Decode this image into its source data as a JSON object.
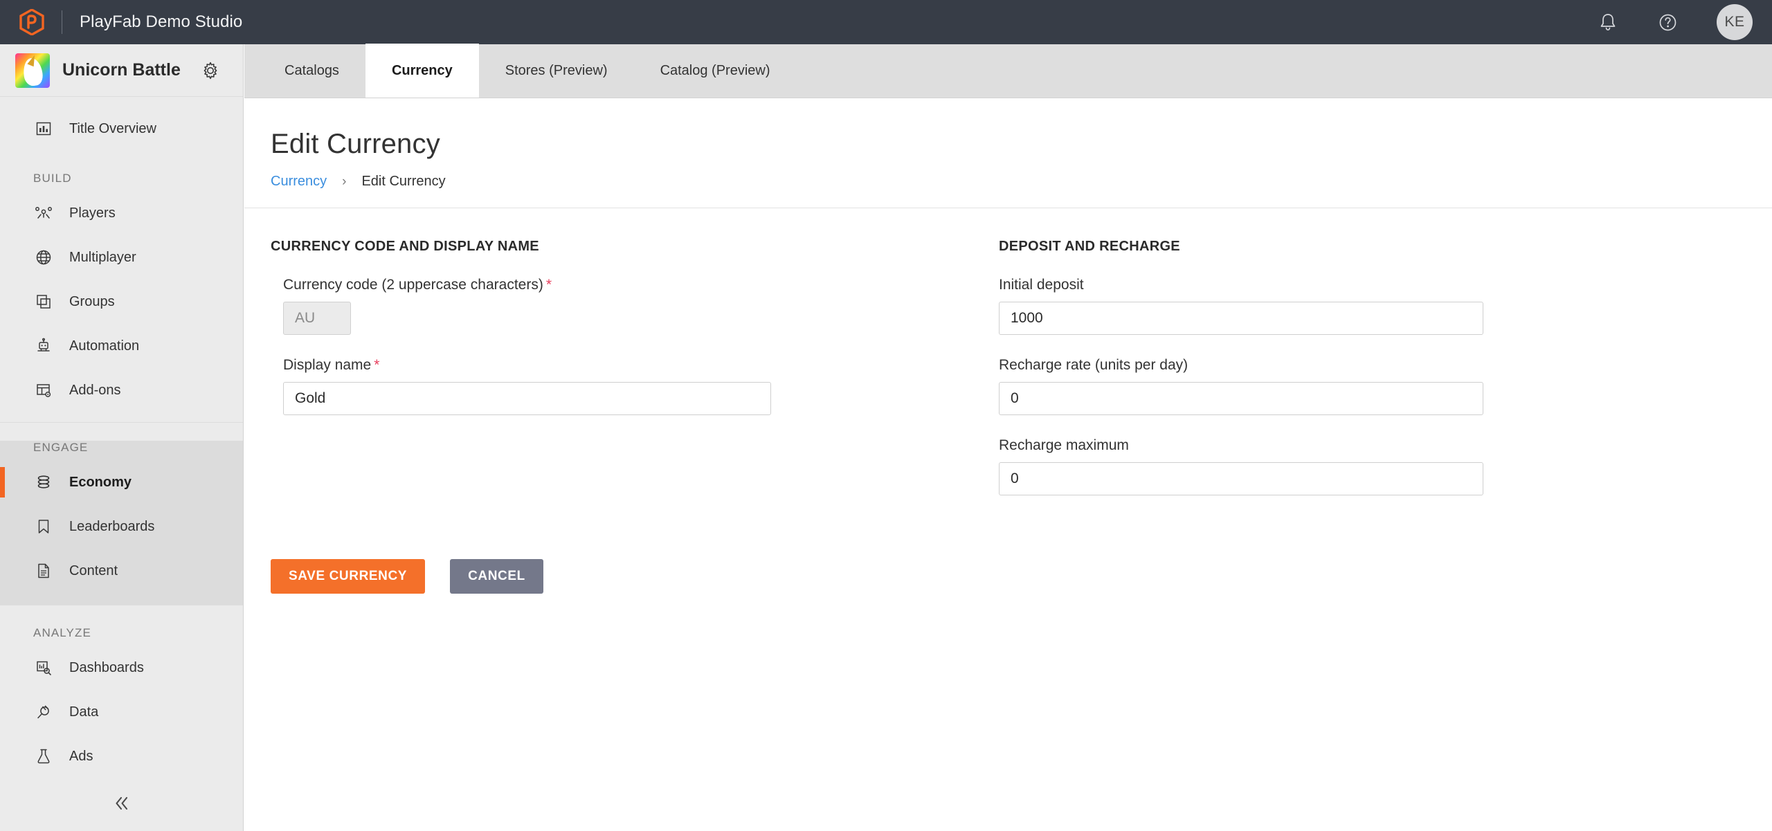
{
  "header": {
    "product_title": "PlayFab Demo Studio",
    "logo_icon": "playfab-hexagon-logo",
    "notifications_icon": "bell-icon",
    "help_icon": "question-circle-icon",
    "avatar_initials": "KE",
    "bg_color": "#373d47"
  },
  "sidebar": {
    "title_name": "Unicorn Battle",
    "title_thumb_icon": "unicorn-title-thumbnail",
    "settings_icon": "gear-icon",
    "collapse_icon": "double-chevron-left-icon",
    "top_items": [
      {
        "label": "Title Overview",
        "icon": "bar-chart-icon"
      }
    ],
    "sections": [
      {
        "label": "BUILD",
        "items": [
          {
            "label": "Players",
            "icon": "players-icon"
          },
          {
            "label": "Multiplayer",
            "icon": "globe-icon"
          },
          {
            "label": "Groups",
            "icon": "stacked-squares-icon"
          },
          {
            "label": "Automation",
            "icon": "robot-icon"
          },
          {
            "label": "Add-ons",
            "icon": "table-gear-icon"
          }
        ]
      },
      {
        "label": "ENGAGE",
        "highlighted": true,
        "items": [
          {
            "label": "Economy",
            "icon": "coins-stack-icon",
            "active": true
          },
          {
            "label": "Leaderboards",
            "icon": "bookmark-icon"
          },
          {
            "label": "Content",
            "icon": "document-icon"
          }
        ]
      },
      {
        "label": "ANALYZE",
        "items": [
          {
            "label": "Dashboards",
            "icon": "dashboard-search-icon"
          },
          {
            "label": "Data",
            "icon": "plug-icon"
          },
          {
            "label": "Ads",
            "icon": "flask-icon"
          }
        ]
      }
    ],
    "bg_color": "#ebebeb",
    "active_indicator_color": "#f26522"
  },
  "tabs": [
    {
      "label": "Catalogs",
      "active": false
    },
    {
      "label": "Currency",
      "active": true
    },
    {
      "label": "Stores (Preview)",
      "active": false
    },
    {
      "label": "Catalog (Preview)",
      "active": false
    }
  ],
  "page": {
    "title": "Edit Currency",
    "breadcrumb": {
      "link": "Currency",
      "separator": "›",
      "current": "Edit Currency",
      "link_color": "#3b8ede"
    }
  },
  "form": {
    "left_section_title": "CURRENCY CODE AND DISPLAY NAME",
    "right_section_title": "DEPOSIT AND RECHARGE",
    "required_marker": "*",
    "fields": {
      "currency_code": {
        "label": "Currency code (2 uppercase characters)",
        "value": "AU",
        "required": true,
        "disabled": true
      },
      "display_name": {
        "label": "Display name",
        "value": "Gold",
        "required": true,
        "disabled": false
      },
      "initial_deposit": {
        "label": "Initial deposit",
        "value": "1000",
        "required": false,
        "disabled": false
      },
      "recharge_rate": {
        "label": "Recharge rate (units per day)",
        "value": "0",
        "required": false,
        "disabled": false
      },
      "recharge_maximum": {
        "label": "Recharge maximum",
        "value": "0",
        "required": false,
        "disabled": false
      }
    },
    "buttons": {
      "save": {
        "label": "SAVE CURRENCY",
        "color": "#f4702a"
      },
      "cancel": {
        "label": "CANCEL",
        "color": "#74788a"
      }
    }
  }
}
